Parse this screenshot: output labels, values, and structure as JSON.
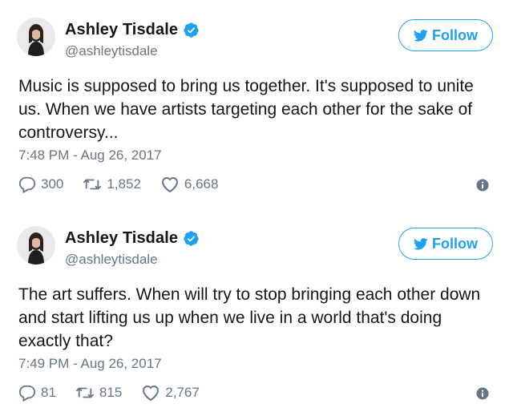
{
  "colors": {
    "accent": "#1da1f2",
    "muted": "#657786",
    "text": "#14171a"
  },
  "tweets": [
    {
      "author_name": "Ashley Tisdale",
      "handle": "@ashleytisdale",
      "follow_label": "Follow",
      "text": "Music is supposed to bring us together. It's supposed to unite us. When we have artists targeting each other for the sake of controversy...",
      "timestamp": "7:48 PM - Aug 26, 2017",
      "replies": "300",
      "retweets": "1,852",
      "likes": "6,668"
    },
    {
      "author_name": "Ashley Tisdale",
      "handle": "@ashleytisdale",
      "follow_label": "Follow",
      "text": "The art suffers. When will try to stop bringing each other down and start lifting us up when we live in a world that's doing exactly that?",
      "timestamp": "7:49 PM - Aug 26, 2017",
      "replies": "81",
      "retweets": "815",
      "likes": "2,767"
    }
  ]
}
